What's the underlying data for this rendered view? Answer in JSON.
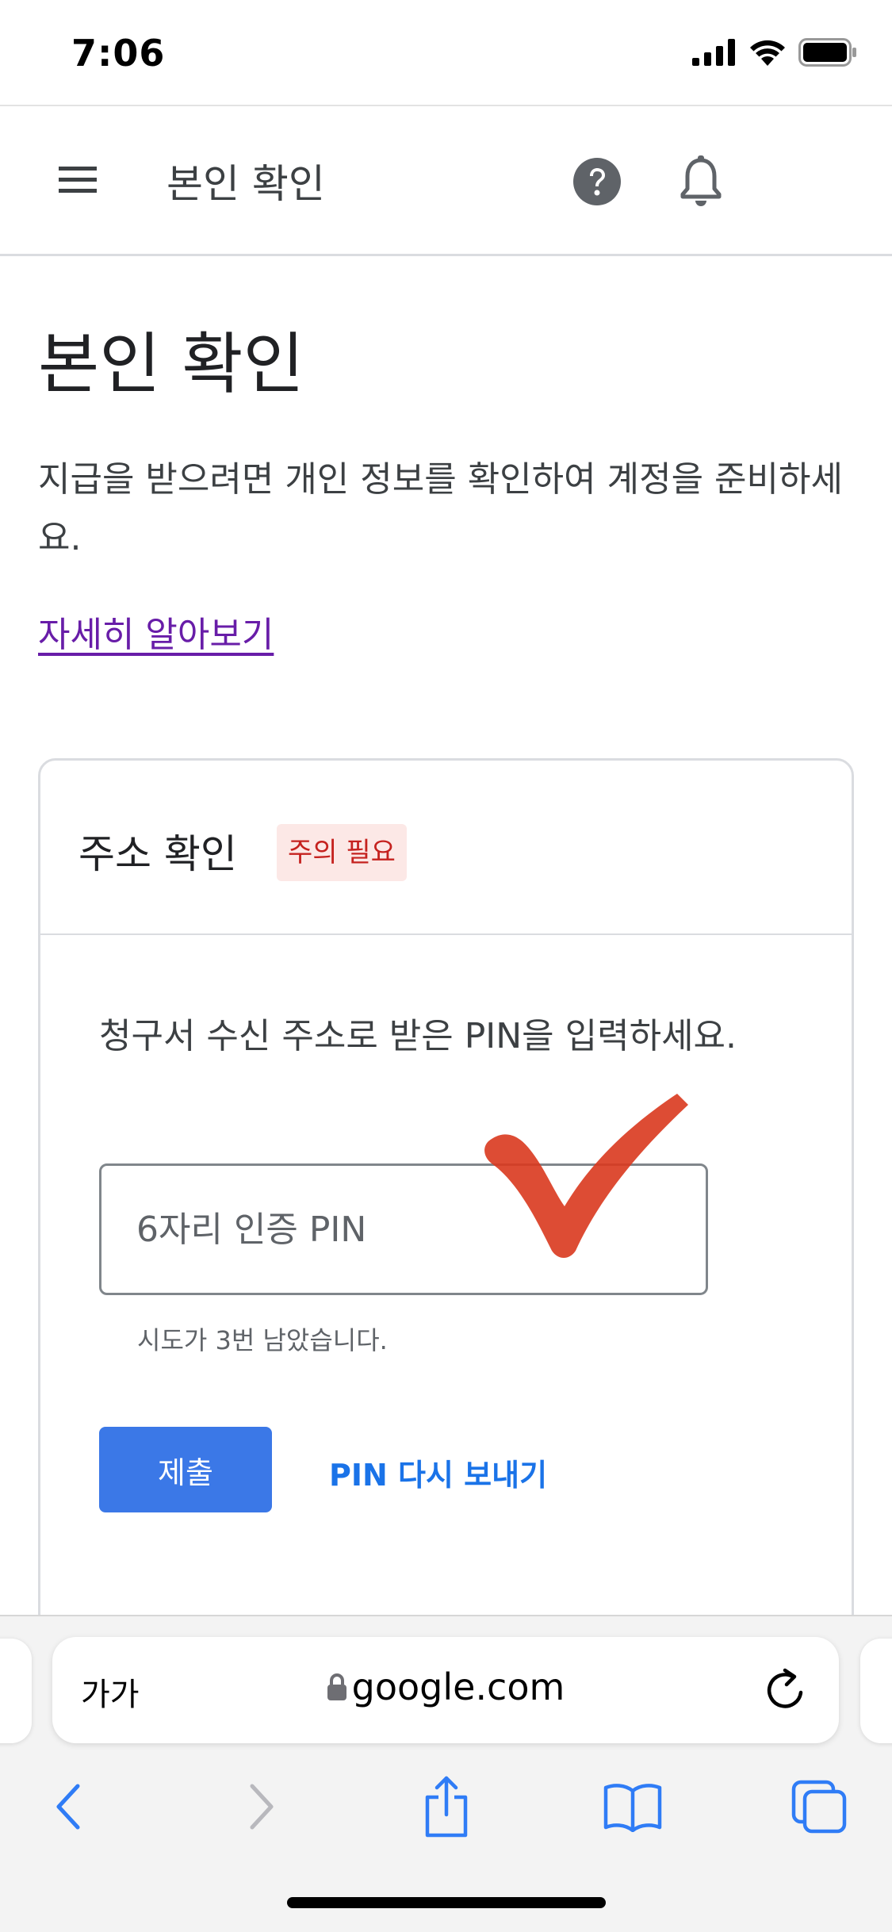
{
  "status_bar": {
    "time": "7:06"
  },
  "app_bar": {
    "title": "본인 확인"
  },
  "page": {
    "title": "본인 확인",
    "description": "지급을 받으려면 개인 정보를 확인하여 계정을 준비하세요.",
    "learn_more": "자세히 알아보기"
  },
  "address_card": {
    "title": "주소 확인",
    "badge": "주의 필요",
    "instructions": "청구서 수신 주소로 받은 PIN을 입력하세요.",
    "pin_placeholder": "6자리 인증 PIN",
    "pin_value": "",
    "attempts_hint": "시도가 3번 남았습니다.",
    "submit_label": "제출",
    "resend_label": "PIN 다시 보내기"
  },
  "browser": {
    "reader_label": "가가",
    "url": "google.com"
  },
  "colors": {
    "primary_button": "#3b78e7",
    "link_blue": "#1a73e8",
    "visited_link": "#681da8",
    "badge_bg": "#fce8e6",
    "badge_text": "#c5221f",
    "annotation_check": "#d9381e",
    "safari_blue": "#2f7cf6"
  },
  "icons": {
    "menu": "hamburger-menu-icon",
    "help": "help-circle-icon",
    "notifications": "bell-icon",
    "annotation": "red-checkmark-annotation",
    "lock": "lock-icon",
    "reload": "reload-icon",
    "back": "chevron-left-icon",
    "forward": "chevron-right-icon",
    "share": "share-icon",
    "bookmarks": "open-book-icon",
    "tabs": "tabs-icon"
  }
}
